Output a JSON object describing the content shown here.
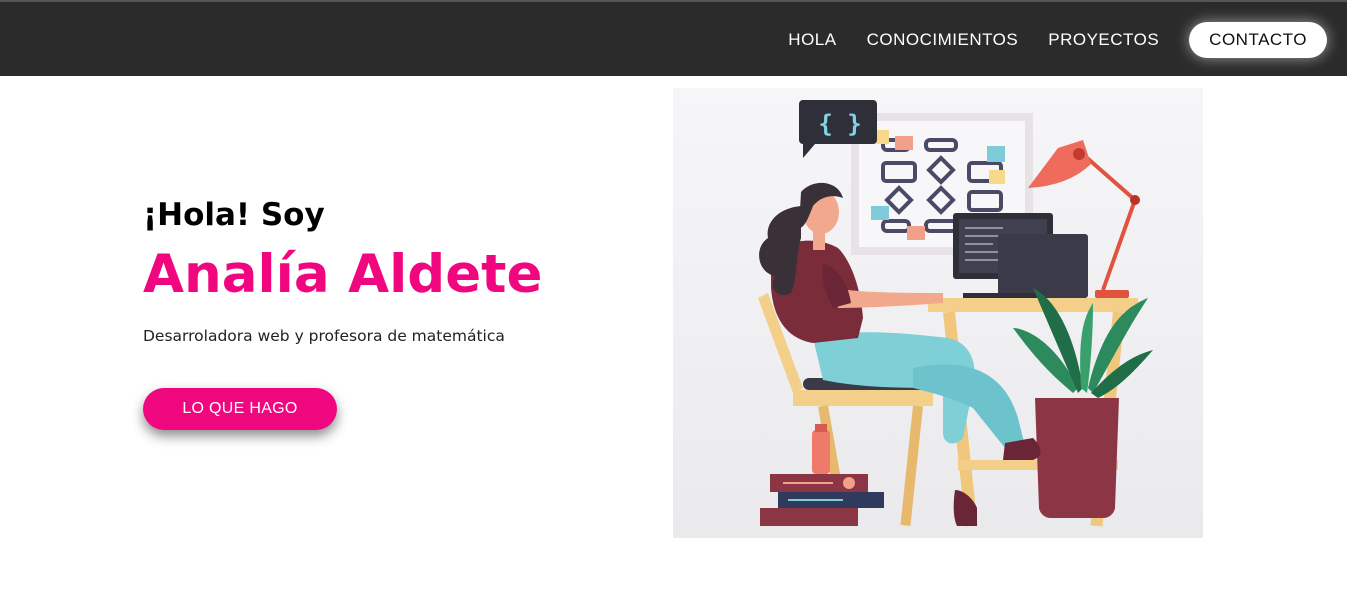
{
  "nav": {
    "items": [
      {
        "label": "HOLA"
      },
      {
        "label": "CONOCIMIENTOS"
      },
      {
        "label": "PROYECTOS"
      }
    ],
    "contact_label": "CONTACTO"
  },
  "hero": {
    "greeting": "¡Hola! Soy",
    "name": "Analía Aldete",
    "subtitle": "Desarroladora web y profesora de matemática",
    "cta_label": "LO QUE HAGO"
  },
  "illustration": {
    "code_bubble": "{ }"
  },
  "colors": {
    "accent": "#f0077f",
    "topbar": "#2b2b2b"
  }
}
